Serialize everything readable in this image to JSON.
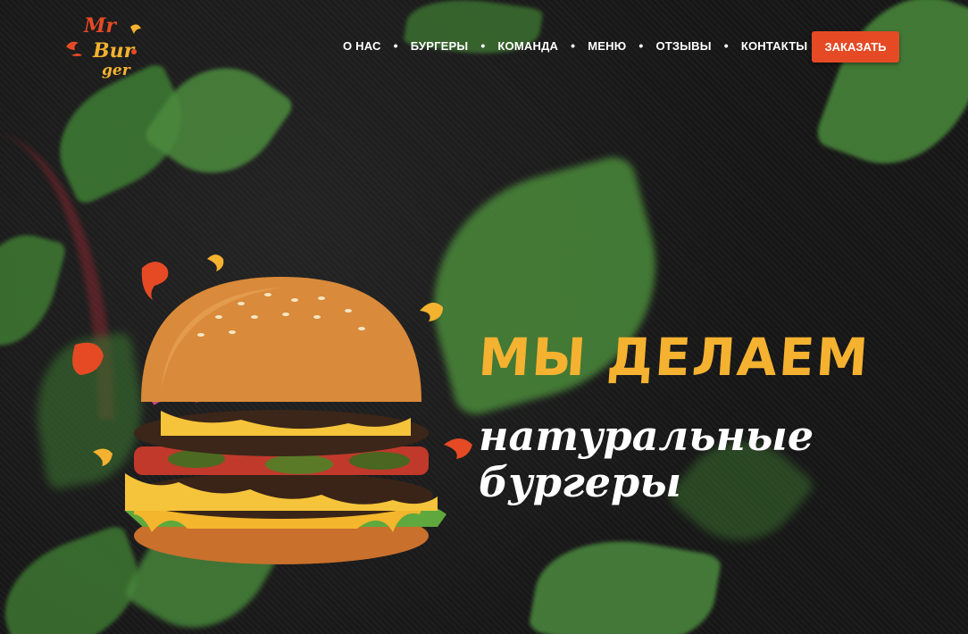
{
  "logo": {
    "text_line1": "Mr",
    "text_line2": "Bur",
    "text_line3": "ger"
  },
  "nav": {
    "items": [
      {
        "label": "О НАС"
      },
      {
        "label": "БУРГЕРЫ"
      },
      {
        "label": "КОМАНДА"
      },
      {
        "label": "МЕНЮ"
      },
      {
        "label": "ОТЗЫВЫ"
      },
      {
        "label": "КОНТАКТЫ"
      }
    ],
    "separator": "•",
    "order_button": "ЗАКАЗАТЬ"
  },
  "hero": {
    "headline_line1": "МЫ ДЕЛАЕМ",
    "headline_line2": "натуральные",
    "headline_line3": "бургеры"
  },
  "colors": {
    "accent": "#e54a25",
    "headline_yellow": "#f4b230",
    "background": "#161616"
  }
}
